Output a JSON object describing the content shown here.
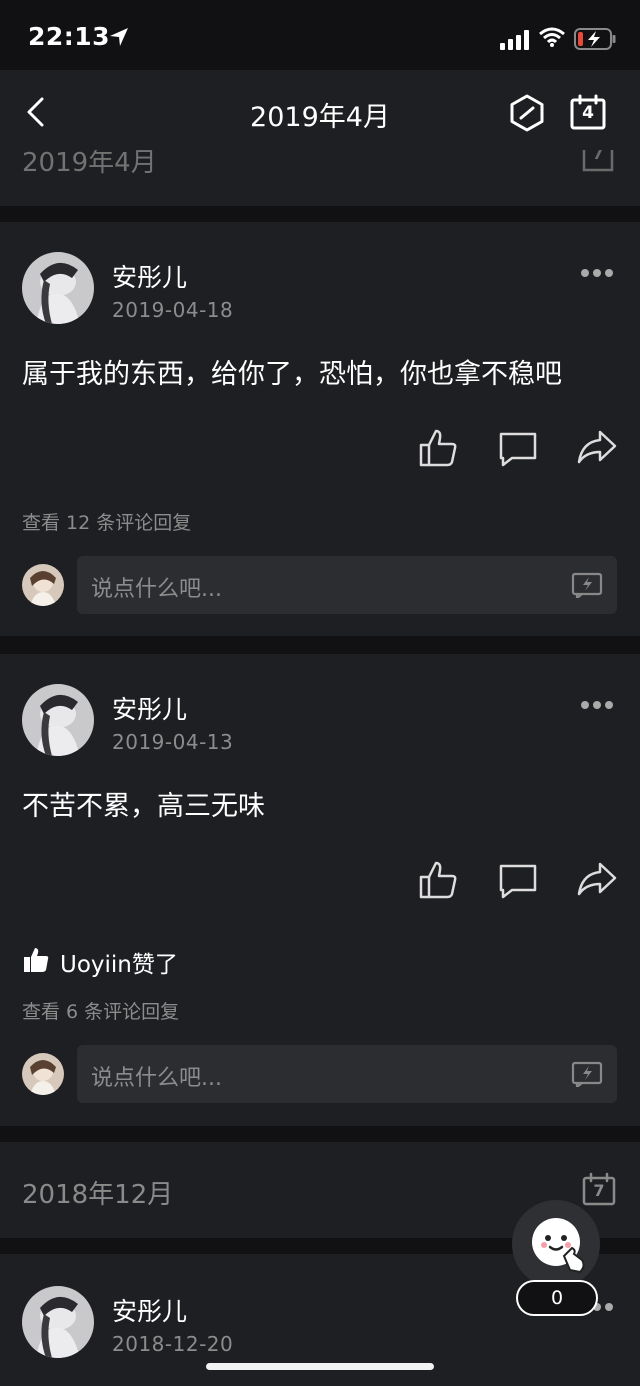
{
  "status_bar": {
    "time": "22:13"
  },
  "header": {
    "title": "2019年4月",
    "calendar_day": "4"
  },
  "month_partial": {
    "label": "2019年4月",
    "calendar_day": "7"
  },
  "posts": [
    {
      "name": "安彤儿",
      "date": "2019-04-18",
      "content": "属于我的东西，给你了，恐怕，你也拿不稳吧",
      "view_replies": "查看 12 条评论回复",
      "comment_placeholder": "说点什么吧..."
    },
    {
      "name": "安彤儿",
      "date": "2019-04-13",
      "content": "不苦不累，高三无味",
      "liked_by": "Uoyiin赞了",
      "view_replies": "查看 6 条评论回复",
      "comment_placeholder": "说点什么吧..."
    },
    {
      "name": "安彤儿",
      "date": "2018-12-20"
    }
  ],
  "month2": {
    "label": "2018年12月",
    "calendar_day": "7"
  },
  "floating": {
    "count": "0"
  }
}
